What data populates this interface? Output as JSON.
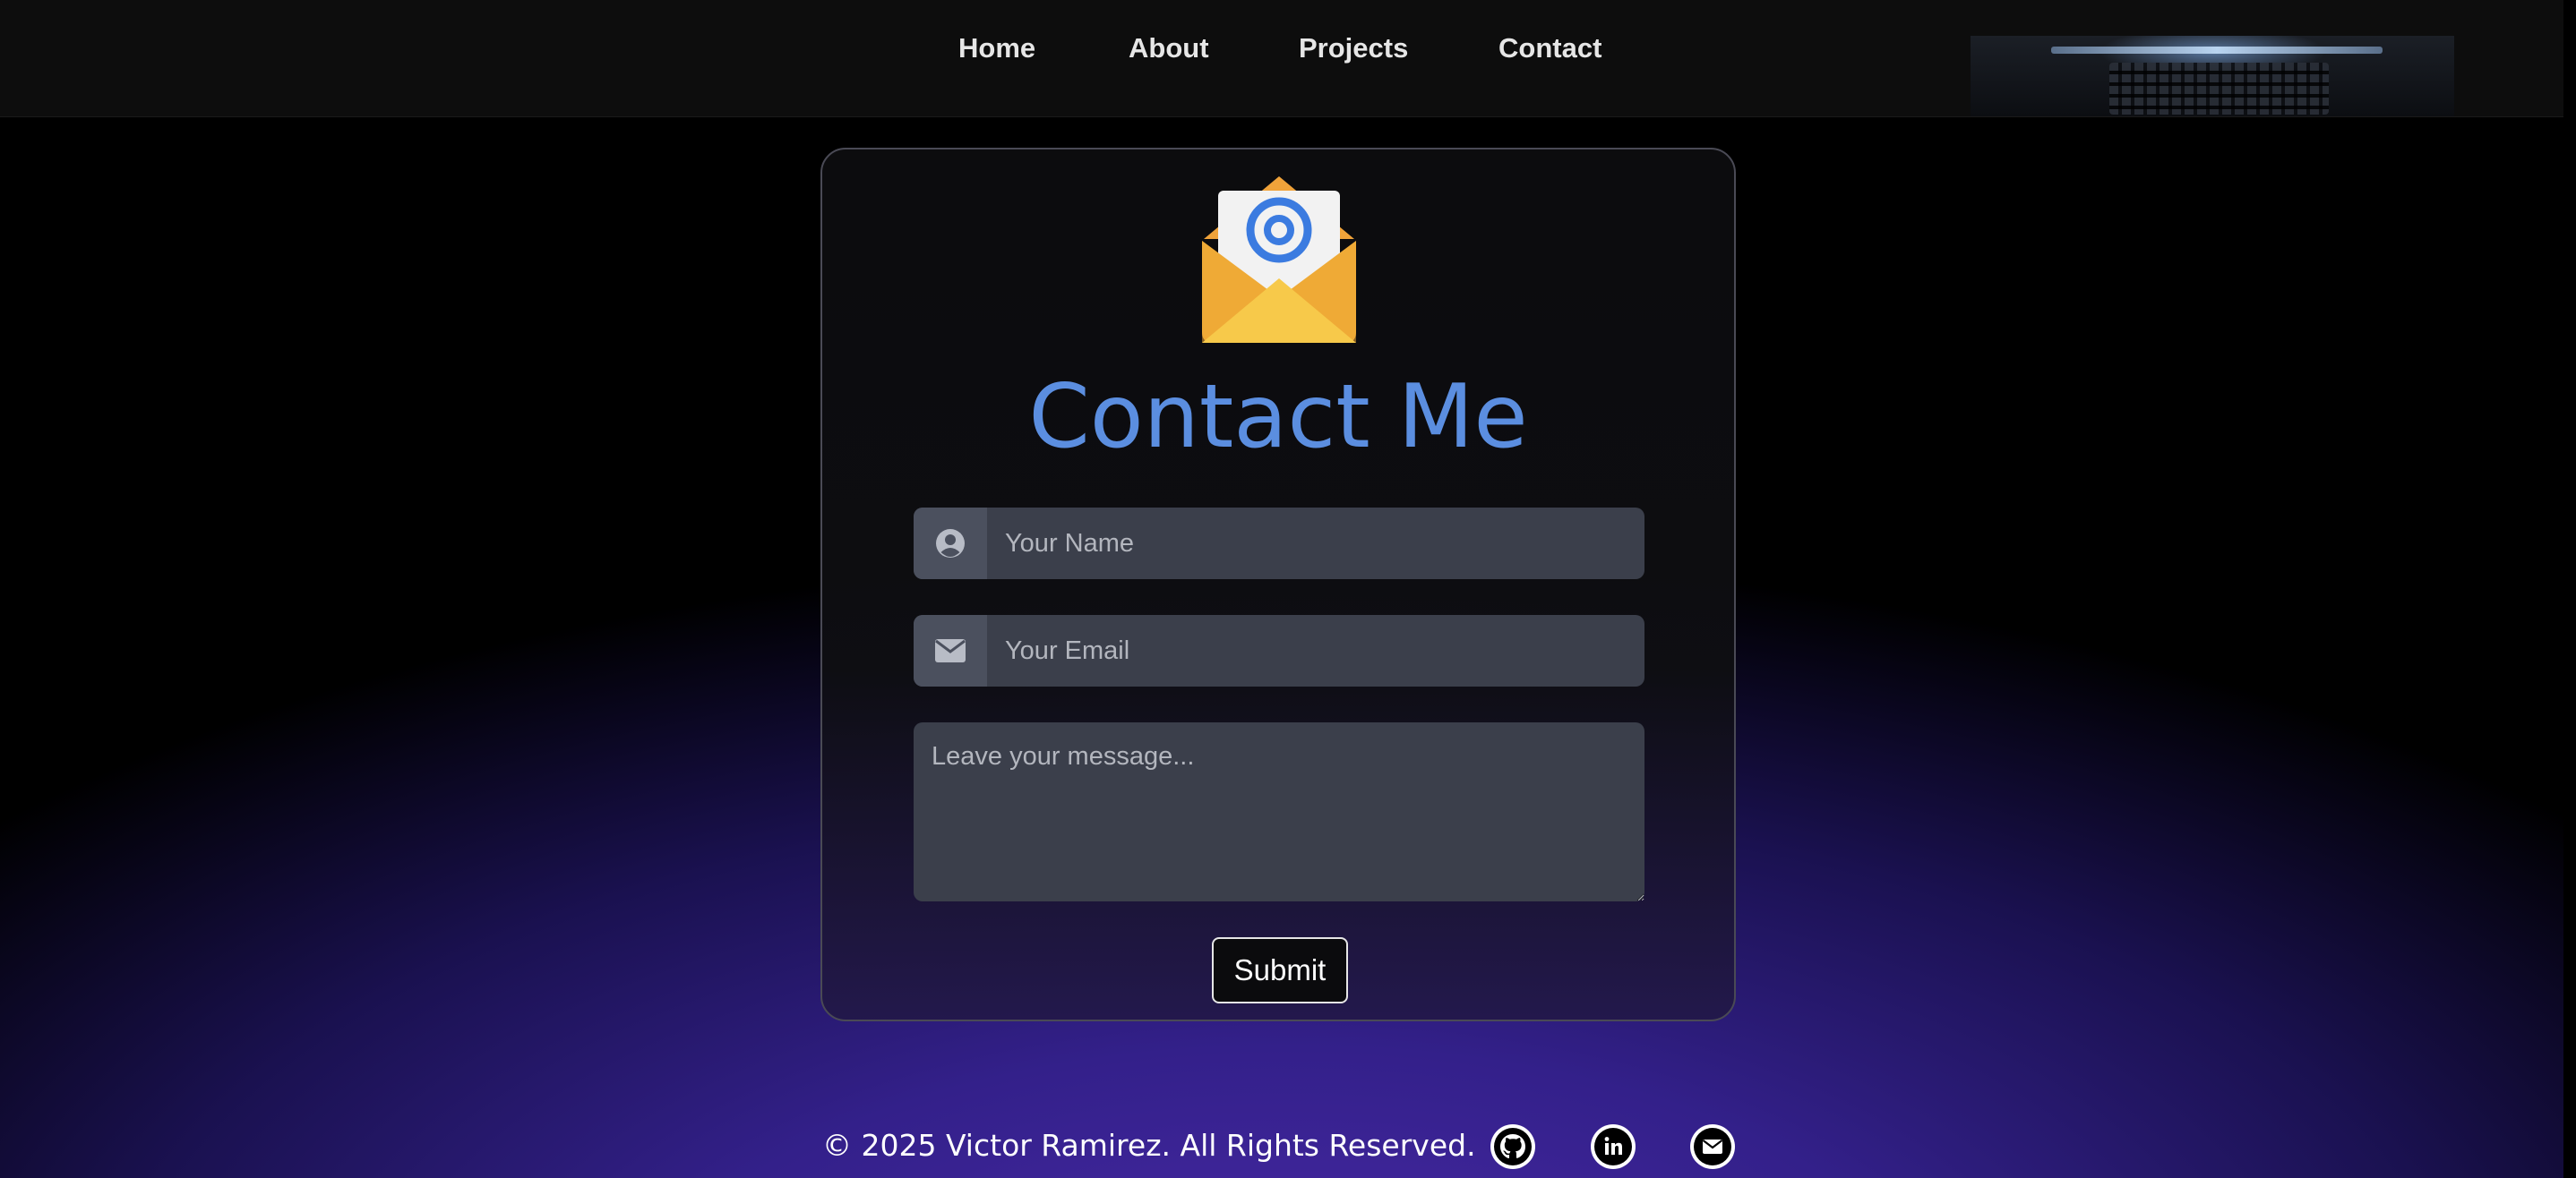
{
  "nav": {
    "links": [
      "Home",
      "About",
      "Projects",
      "Contact"
    ]
  },
  "header_image": "laptop-keyboard-photo",
  "contact_card": {
    "icon": "envelope-at-icon",
    "title": "Contact Me",
    "name_placeholder": "Your Name",
    "email_placeholder": "Your Email",
    "message_placeholder": "Leave your message...",
    "submit_label": "Submit"
  },
  "footer": {
    "copyright": "© 2025 Victor Ramirez. All Rights Reserved.",
    "social_icons": [
      "github-icon",
      "linkedin-icon",
      "mail-icon"
    ]
  },
  "colors": {
    "accent": "#5b8ee0",
    "background_gradient_bottom": "#4a2aa8",
    "input_bg": "#3b3f4b"
  }
}
